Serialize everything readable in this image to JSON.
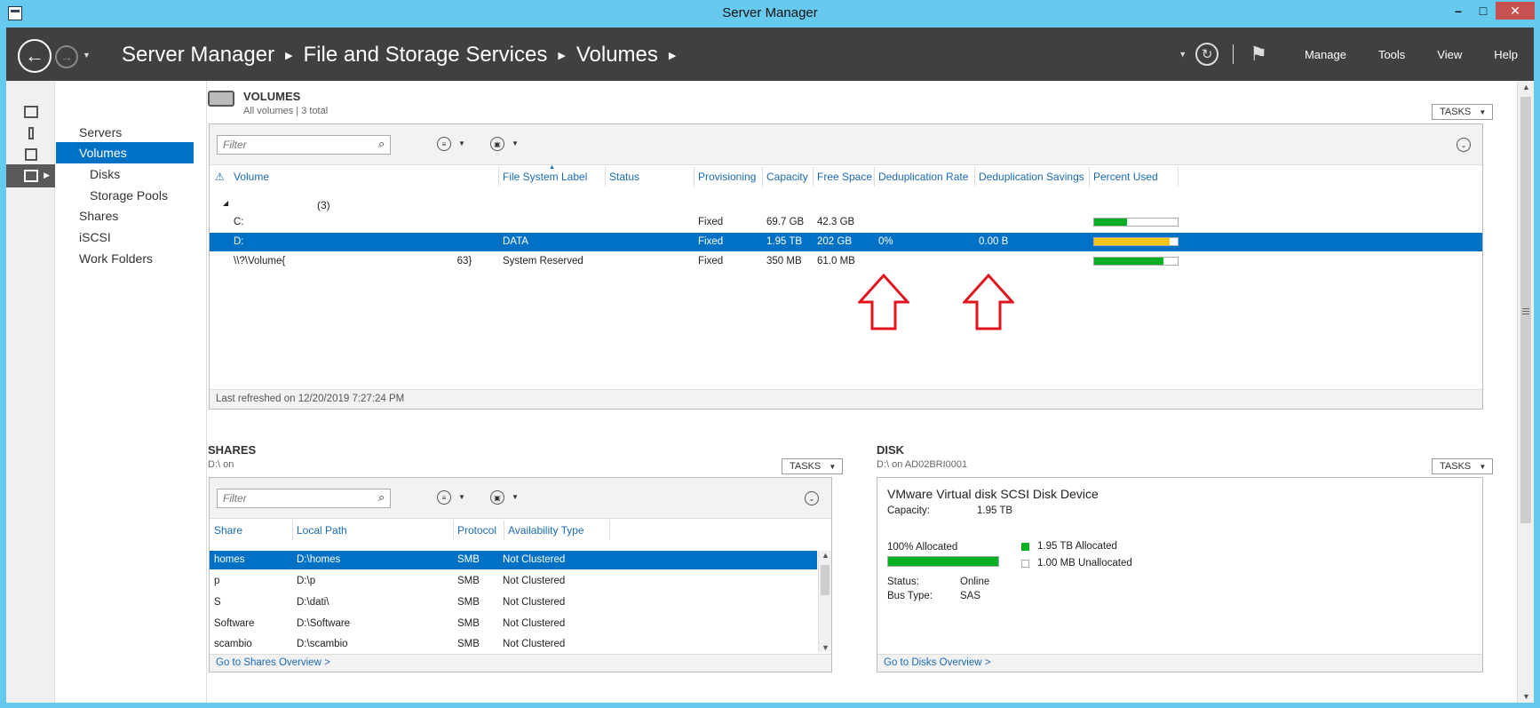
{
  "window": {
    "title": "Server Manager"
  },
  "header": {
    "breadcrumb": [
      "Server Manager",
      "File and Storage Services",
      "Volumes"
    ],
    "menu": [
      "Manage",
      "Tools",
      "View",
      "Help"
    ]
  },
  "nav": {
    "items": [
      {
        "label": "Servers",
        "sub": false,
        "active": false
      },
      {
        "label": "Volumes",
        "sub": false,
        "active": true
      },
      {
        "label": "Disks",
        "sub": true,
        "active": false
      },
      {
        "label": "Storage Pools",
        "sub": true,
        "active": false
      },
      {
        "label": "Shares",
        "sub": false,
        "active": false
      },
      {
        "label": "iSCSI",
        "sub": false,
        "active": false
      },
      {
        "label": "Work Folders",
        "sub": false,
        "active": false
      }
    ]
  },
  "volumes": {
    "title": "VOLUMES",
    "subtitle": "All volumes | 3 total",
    "tasks_label": "TASKS",
    "filter_placeholder": "Filter",
    "columns": [
      "Volume",
      "File System Label",
      "Status",
      "Provisioning",
      "Capacity",
      "Free Space",
      "Deduplication Rate",
      "Deduplication Savings",
      "Percent Used"
    ],
    "group_label": "(3)",
    "rows": [
      {
        "volume": "C:",
        "label": "",
        "status": "",
        "provisioning": "Fixed",
        "capacity": "69.7 GB",
        "free": "42.3 GB",
        "dedup_rate": "",
        "dedup_savings": "",
        "percent_used": 0.39,
        "selected": false
      },
      {
        "volume": "D:",
        "label": "DATA",
        "status": "",
        "provisioning": "Fixed",
        "capacity": "1.95 TB",
        "free": "202 GB",
        "dedup_rate": "0%",
        "dedup_savings": "0.00 B",
        "percent_used": 0.9,
        "selected": true
      },
      {
        "volume": "\\\\?\\Volume{                                                                                    63}",
        "label": "System Reserved",
        "status": "",
        "provisioning": "Fixed",
        "capacity": "350 MB",
        "free": "61.0 MB",
        "dedup_rate": "",
        "dedup_savings": "",
        "percent_used": 0.83,
        "selected": false
      }
    ],
    "last_refreshed": "Last refreshed on 12/20/2019 7:27:24 PM"
  },
  "shares": {
    "title": "SHARES",
    "subtitle": "D:\\ on",
    "tasks_label": "TASKS",
    "filter_placeholder": "Filter",
    "columns": [
      "Share",
      "Local Path",
      "Protocol",
      "Availability Type"
    ],
    "rows": [
      {
        "share": "homes",
        "path": "D:\\homes",
        "protocol": "SMB",
        "availability": "Not Clustered",
        "selected": true
      },
      {
        "share": "p",
        "path": "D:\\p",
        "protocol": "SMB",
        "availability": "Not Clustered",
        "selected": false
      },
      {
        "share": "S",
        "path": "D:\\dati\\",
        "protocol": "SMB",
        "availability": "Not Clustered",
        "selected": false
      },
      {
        "share": "Software",
        "path": "D:\\Software",
        "protocol": "SMB",
        "availability": "Not Clustered",
        "selected": false
      },
      {
        "share": "scambio",
        "path": "D:\\scambio",
        "protocol": "SMB",
        "availability": "Not Clustered",
        "selected": false
      }
    ],
    "overview_link": "Go to Shares Overview >"
  },
  "disk": {
    "title": "DISK",
    "subtitle": "D:\\ on AD02BRI0001",
    "tasks_label": "TASKS",
    "device": "VMware Virtual disk SCSI Disk Device",
    "capacity_label": "Capacity:",
    "capacity_value": "1.95 TB",
    "allocated_label": "100% Allocated",
    "allocated_fraction": 1.0,
    "legend": [
      {
        "label": "1.95 TB Allocated",
        "color": "#06b025"
      },
      {
        "label": "1.00 MB Unallocated",
        "color": "#ffffff"
      }
    ],
    "status_label": "Status:",
    "status_value": "Online",
    "bus_label": "Bus Type:",
    "bus_value": "SAS",
    "overview_link": "Go to Disks Overview >"
  },
  "colors": {
    "accent": "#0071c5",
    "header": "#404040",
    "frame": "#66c9ee",
    "bar_green": "#06b025",
    "bar_yellow": "#f5c518",
    "annotation_red": "#e0141e"
  }
}
